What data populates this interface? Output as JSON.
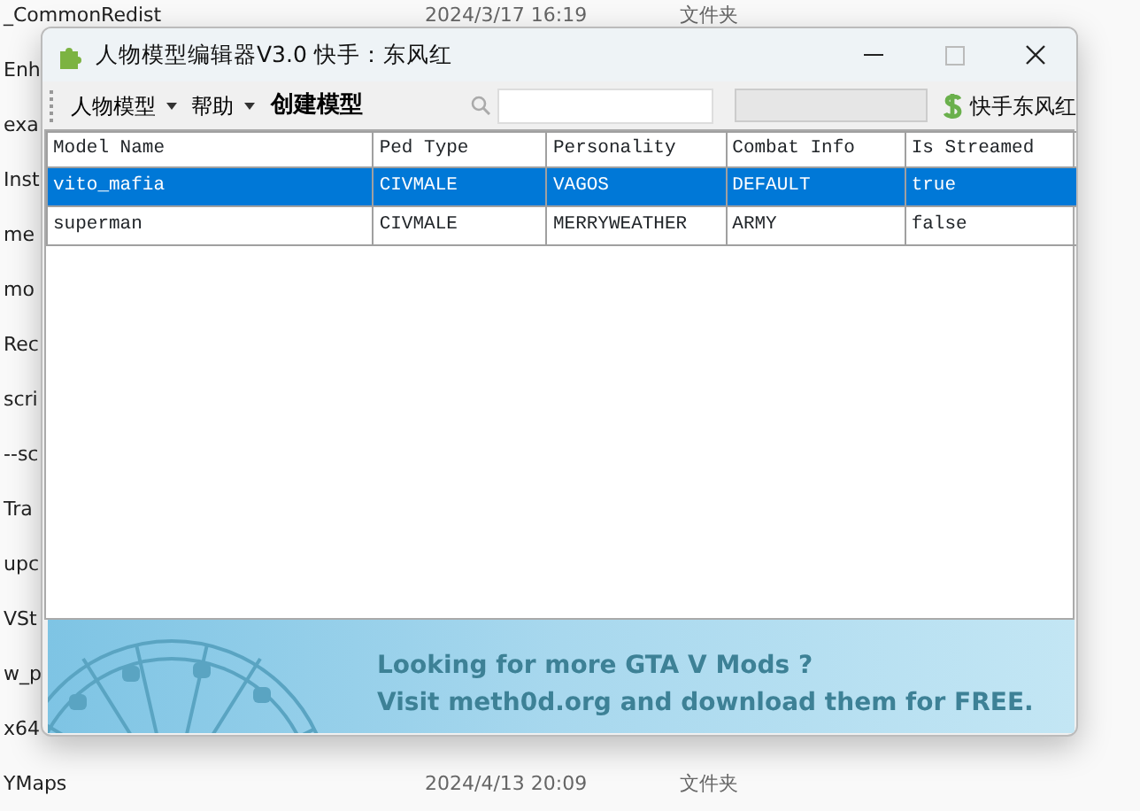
{
  "background_files": [
    {
      "name": "_CommonRedist",
      "date": "2024/3/17 16:19",
      "type": "文件夹"
    },
    {
      "name": "Enh"
    },
    {
      "name": "exa"
    },
    {
      "name": "Inst"
    },
    {
      "name": "me"
    },
    {
      "name": "mo"
    },
    {
      "name": "Rec"
    },
    {
      "name": "scri"
    },
    {
      "name": "--sc"
    },
    {
      "name": "Tra"
    },
    {
      "name": "upc"
    },
    {
      "name": "VSt"
    },
    {
      "name": "w_p"
    },
    {
      "name": "x64"
    },
    {
      "name": "YMaps",
      "date": "2024/4/13 20:09",
      "type": "文件夹"
    }
  ],
  "window": {
    "title": "人物模型编辑器V3.0 快手：东风红"
  },
  "toolbar": {
    "menus": [
      {
        "label": "人物模型",
        "dropdown": true
      },
      {
        "label": "帮助",
        "dropdown": true
      }
    ],
    "create_button": "创建模型",
    "status_field": {
      "disabled": true
    },
    "author_link": "快手东风红"
  },
  "table": {
    "columns": [
      "Model Name",
      "Ped Type",
      "Personality",
      "Combat Info",
      "Is Streamed"
    ],
    "rows": [
      {
        "cells": [
          "vito_mafia",
          "CIVMALE",
          "VAGOS",
          "DEFAULT",
          "true"
        ],
        "selected": true
      },
      {
        "cells": [
          "superman",
          "CIVMALE",
          "MERRYWEATHER",
          "ARMY",
          "false"
        ],
        "selected": false
      }
    ]
  },
  "banner": {
    "lines": [
      "Looking for more GTA V Mods ?",
      "Visit meth0d.org and download them for FREE."
    ]
  }
}
